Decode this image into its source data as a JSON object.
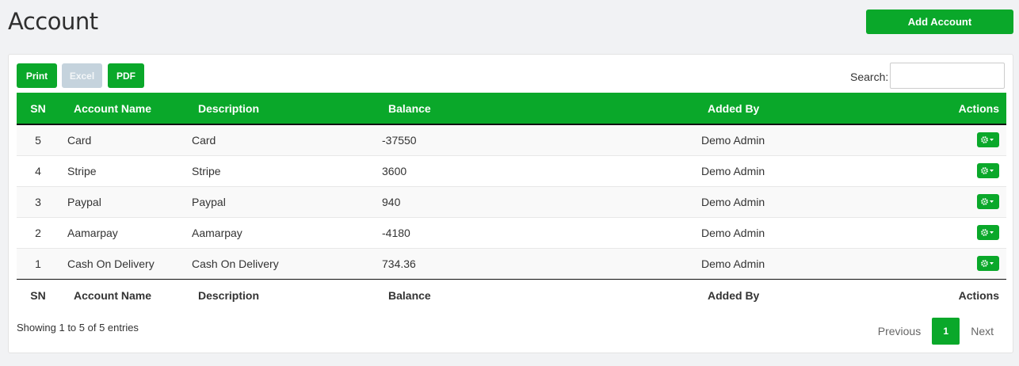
{
  "page": {
    "title": "Account",
    "add_label": "Add Account"
  },
  "toolbar": {
    "print": "Print",
    "excel": "Excel",
    "pdf": "PDF",
    "search_label": "Search:",
    "search_value": ""
  },
  "table": {
    "columns": [
      "SN",
      "Account Name",
      "Description",
      "Balance",
      "Added By",
      "Actions"
    ],
    "rows": [
      {
        "sn": "5",
        "name": "Card",
        "description": "Card",
        "balance": "-37550",
        "added_by": "Demo Admin"
      },
      {
        "sn": "4",
        "name": "Stripe",
        "description": "Stripe",
        "balance": "3600",
        "added_by": "Demo Admin"
      },
      {
        "sn": "3",
        "name": "Paypal",
        "description": "Paypal",
        "balance": "940",
        "added_by": "Demo Admin"
      },
      {
        "sn": "2",
        "name": "Aamarpay",
        "description": "Aamarpay",
        "balance": "-4180",
        "added_by": "Demo Admin"
      },
      {
        "sn": "1",
        "name": "Cash On Delivery",
        "description": "Cash On Delivery",
        "balance": "734.36",
        "added_by": "Demo Admin"
      }
    ]
  },
  "footer": {
    "info": "Showing 1 to 5 of 5 entries",
    "previous": "Previous",
    "current_page": "1",
    "next": "Next"
  },
  "colors": {
    "accent": "#0aa82a",
    "disabled": "#c5d3dd"
  }
}
